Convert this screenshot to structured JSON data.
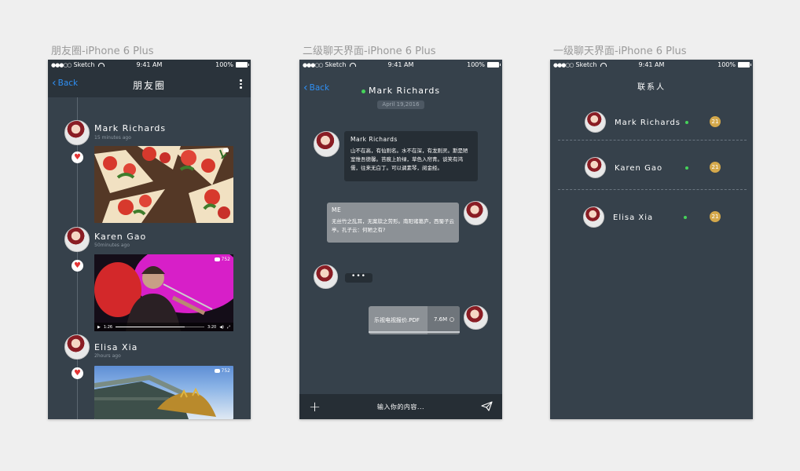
{
  "captions": {
    "moments": "朋友圈-iPhone 6 Plus",
    "chat": "二级聊天界面-iPhone 6 Plus",
    "contacts": "一级聊天界面-iPhone 6 Plus"
  },
  "statusbar": {
    "carrier": "Sketch",
    "time": "9:41 AM",
    "battery": "100%"
  },
  "moments": {
    "back_label": "Back",
    "title": "朋友圈",
    "posts": [
      {
        "name": "Mark Richards",
        "time": "15 minutes ago",
        "comments": ""
      },
      {
        "name": "Karen Gao",
        "time": "50minutes ago",
        "comments": "752",
        "video_elapsed": "1:26",
        "video_total": "3:20",
        "video_progress": 0.78
      },
      {
        "name": "Elisa Xia",
        "time": "2hours ago",
        "comments": "752"
      }
    ]
  },
  "chat": {
    "back_label": "Back",
    "title": "Mark Richards",
    "date": "April 19,2016",
    "messages": [
      {
        "sender": "Mark Richards",
        "text": "山不在高，有仙则名。水不在深，有龙则灵。斯是陋室惟吾德馨。苔痕上阶绿，草色入帘青。谈笑有鸿儒，往来无白丁。可以调素琴，阅金经。"
      },
      {
        "sender": "ME",
        "text": "无丝竹之乱耳，无案牍之劳形。南阳诸葛庐，西蜀子云亭。孔子云：何陋之有?"
      }
    ],
    "typing": "•••",
    "file": {
      "name": "乐视电视报价.PDF",
      "size": "7.6M"
    },
    "input_placeholder": "输入你的内容..."
  },
  "contacts": {
    "title": "联系人",
    "items": [
      {
        "name": "Mark Richards",
        "count": "21"
      },
      {
        "name": "Karen Gao",
        "count": "21"
      },
      {
        "name": "Elisa Xia",
        "count": "21"
      }
    ]
  },
  "colors": {
    "background": "#efefef",
    "phone_bg": "#36414b",
    "bar_bg": "#2a333b",
    "accent_blue": "#2f8ff3",
    "online_green": "#45d35a",
    "badge_gold": "#d4a84b",
    "heart_red": "#e43535"
  }
}
